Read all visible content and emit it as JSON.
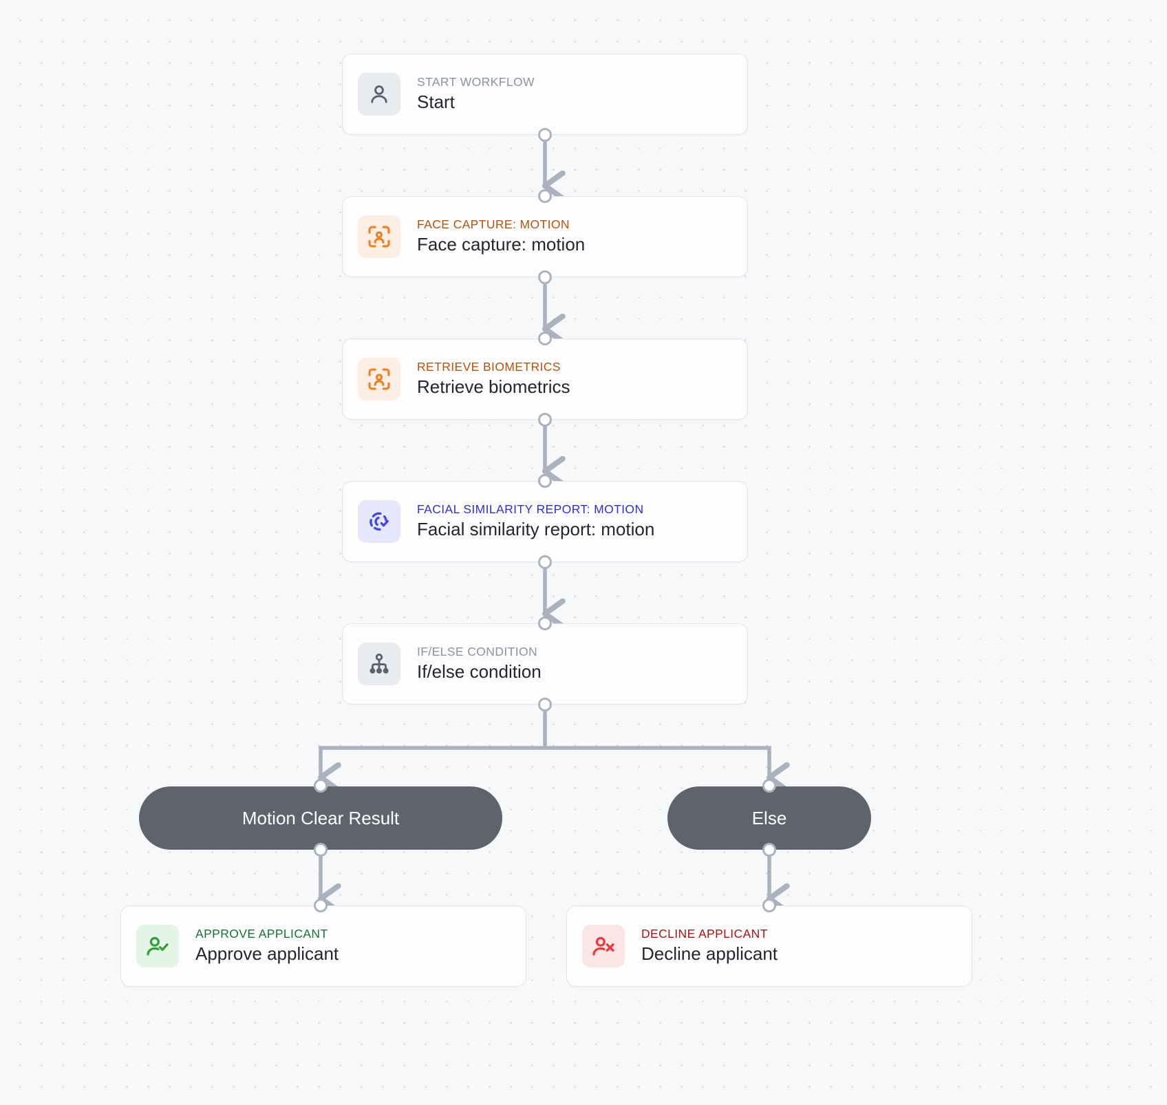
{
  "canvas": {
    "background_color": "#f6f8fa",
    "dot_grid_color": "#c9d2dc",
    "connector_color": "#a9b2be"
  },
  "nodes": [
    {
      "id": "start",
      "kicker": "START WORKFLOW",
      "title": "Start",
      "icon": "person-icon",
      "icon_color": "#5a616b",
      "icon_bg": "#e8ebef",
      "kicker_color": "#8a93a0"
    },
    {
      "id": "face-capture-motion",
      "kicker": "FACE CAPTURE: MOTION",
      "title": "Face capture: motion",
      "icon": "face-scan-icon",
      "icon_color": "#ef8022",
      "icon_bg": "#fdeee3",
      "kicker_color": "#b2530d"
    },
    {
      "id": "retrieve-biometrics",
      "kicker": "RETRIEVE BIOMETRICS",
      "title": "Retrieve biometrics",
      "icon": "face-scan-icon",
      "icon_color": "#ef8022",
      "icon_bg": "#fdeee3",
      "kicker_color": "#b2530d"
    },
    {
      "id": "facial-similarity-report-motion",
      "kicker": "FACIAL SIMILARITY REPORT: MOTION",
      "title": "Facial similarity report: motion",
      "icon": "biometric-check-icon",
      "icon_color": "#4346ef",
      "icon_bg": "#e6e7fb",
      "kicker_color": "#2d2fd4"
    },
    {
      "id": "if-else-condition",
      "kicker": "IF/ELSE CONDITION",
      "title": "If/else condition",
      "icon": "branch-hierarchy-icon",
      "icon_color": "#5a616b",
      "icon_bg": "#e8ebef",
      "kicker_color": "#8a93a0"
    },
    {
      "id": "approve-applicant",
      "kicker": "APPROVE APPLICANT",
      "title": "Approve applicant",
      "icon": "person-check-icon",
      "icon_color": "#2fa336",
      "icon_bg": "#e4f4e6",
      "kicker_color": "#137333"
    },
    {
      "id": "decline-applicant",
      "kicker": "DECLINE APPLICANT",
      "title": "Decline applicant",
      "icon": "person-x-icon",
      "icon_color": "#eb3a3a",
      "icon_bg": "#fbe6e6",
      "kicker_color": "#a81414"
    }
  ],
  "branches": [
    {
      "id": "branch-motion-clear-result",
      "label": "Motion Clear Result"
    },
    {
      "id": "branch-else",
      "label": "Else"
    }
  ]
}
